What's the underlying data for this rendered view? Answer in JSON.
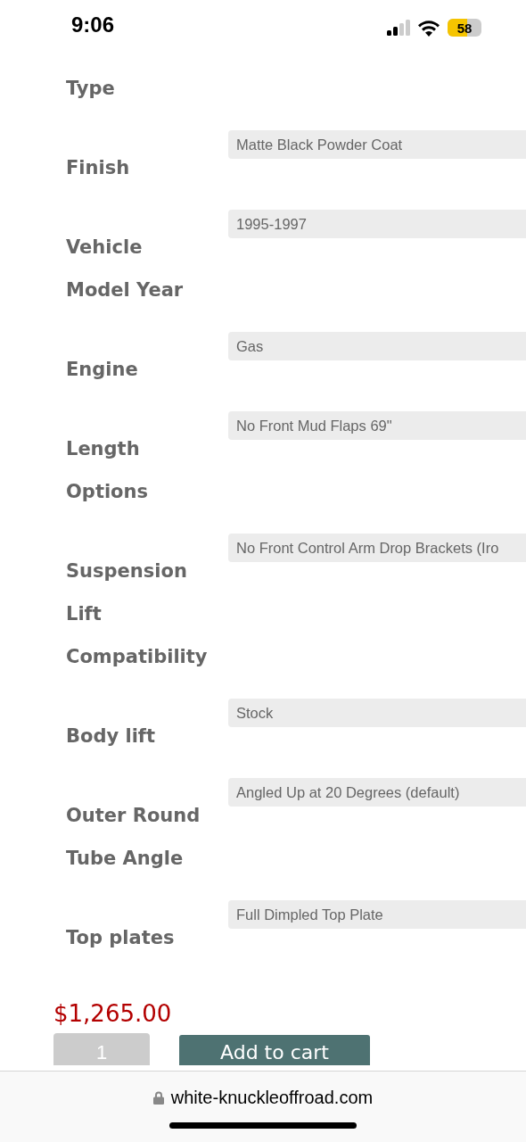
{
  "status_bar": {
    "time": "9:06",
    "battery": "58"
  },
  "options": [
    {
      "label": "Type"
    },
    {
      "label": "Finish",
      "value": "Matte Black Powder Coat"
    },
    {
      "label": "Vehicle Model Year",
      "value": "1995-1997"
    },
    {
      "label": "Engine",
      "value": "Gas"
    },
    {
      "label": "Length Options",
      "value": "No Front Mud Flaps 69\""
    },
    {
      "label": "Suspension Lift Compatibility",
      "value": "No Front Control Arm Drop Brackets (Iro"
    },
    {
      "label": "Body lift",
      "value": "Stock"
    },
    {
      "label": "Outer Round Tube Angle",
      "value": "Angled Up at 20 Degrees (default)"
    },
    {
      "label": "Top plates",
      "value": "Full Dimpled Top Plate"
    }
  ],
  "price": "$1,265.00",
  "quantity": "1",
  "add_to_cart": "Add to cart",
  "browser_bar": {
    "url": "white-knuckleoffroad.com"
  }
}
